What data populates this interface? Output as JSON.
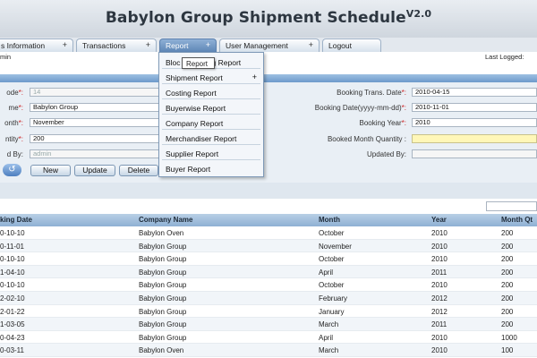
{
  "app": {
    "title": "Babylon Group Shipment Schedule",
    "version": "V2.0"
  },
  "nav": {
    "tabs": [
      {
        "label": "s Information",
        "plus": "+"
      },
      {
        "label": "Transactions",
        "plus": "+"
      },
      {
        "label": "Report",
        "plus": "+"
      },
      {
        "label": "User Management",
        "plus": "+"
      },
      {
        "label": "Logout"
      }
    ]
  },
  "userbar": {
    "user": "min",
    "last_logged": "Last Logged:"
  },
  "report_menu": {
    "items": [
      {
        "label": "Bloc",
        "label_tail": "g Report"
      },
      {
        "label": "Shipment Report",
        "arrow": "+"
      },
      {
        "label": "Costing Report"
      },
      {
        "label": "Buyerwise Report"
      },
      {
        "label": "Company Report"
      },
      {
        "label": "Merchandiser Report"
      },
      {
        "label": "Supplier Report"
      },
      {
        "label": "Buyer Report"
      }
    ],
    "tooltip": "Report"
  },
  "form": {
    "left": [
      {
        "label": "ode",
        "req": "*:",
        "value": "14"
      },
      {
        "label": "me",
        "req": "*:",
        "value": "Babylon Group"
      },
      {
        "label": "onth",
        "req": "*:",
        "value": "November"
      },
      {
        "label": "ntity",
        "req": "*:",
        "value": "200"
      },
      {
        "label": "d By:",
        "req": "",
        "value": "admin"
      }
    ],
    "right": [
      {
        "label": "Booking Trans. Date",
        "req": "*:",
        "value": "2010-04-15"
      },
      {
        "label": "Booking Date(yyyy-mm-dd)",
        "req": "*:",
        "value": "2010-11-01"
      },
      {
        "label": "Booking Year",
        "req": "*:",
        "value": "2010"
      },
      {
        "label": "Booked Month Quantity :",
        "req": "",
        "value": ""
      },
      {
        "label": "Updated By:",
        "req": "",
        "value": ""
      }
    ],
    "buttons": {
      "undo": "↺",
      "new": "New",
      "update": "Update",
      "delete": "Delete"
    }
  },
  "grid": {
    "columns": [
      "king Date",
      "Company Name",
      "Month",
      "Year",
      "Month Qt"
    ],
    "rows": [
      [
        "0-10-10",
        "Babylon Oven",
        "October",
        "2010",
        "200"
      ],
      [
        "0-11-01",
        "Babylon Group",
        "November",
        "2010",
        "200"
      ],
      [
        "0-10-10",
        "Babylon Group",
        "October",
        "2010",
        "200"
      ],
      [
        "1-04-10",
        "Babylon Group",
        "April",
        "2011",
        "200"
      ],
      [
        "0-10-10",
        "Babylon Group",
        "October",
        "2010",
        "200"
      ],
      [
        "2-02-10",
        "Babylon Group",
        "February",
        "2012",
        "200"
      ],
      [
        "2-01-22",
        "Babylon Group",
        "January",
        "2012",
        "200"
      ],
      [
        "1-03-05",
        "Babylon Group",
        "March",
        "2011",
        "200"
      ],
      [
        "0-04-23",
        "Babylon Group",
        "April",
        "2010",
        "1000"
      ],
      [
        "0-03-11",
        "Babylon Oven",
        "March",
        "2010",
        "100"
      ]
    ]
  }
}
